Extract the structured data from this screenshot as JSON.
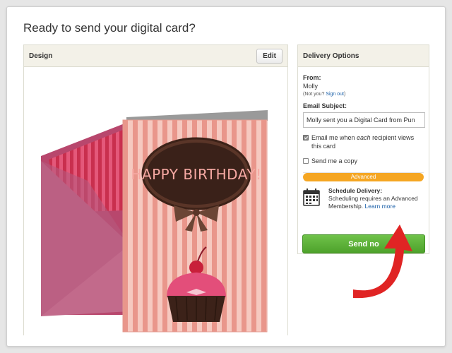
{
  "page": {
    "title": "Ready to send your digital card?"
  },
  "design": {
    "header": "Design",
    "edit_label": "Edit",
    "card_text": "HAPPY BIRTHDAY!"
  },
  "delivery": {
    "header": "Delivery Options",
    "from_label": "From:",
    "sender_name": "Molly",
    "not_you_prefix": "(Not you? ",
    "sign_out_label": "Sign out",
    "not_you_suffix": ")",
    "email_subject_label": "Email Subject:",
    "email_subject_value": "Molly sent you a Digital Card from Pun",
    "notify_prefix": "Email me when ",
    "notify_each": "each",
    "notify_suffix": " recipient views this card",
    "notify_checked": true,
    "copy_label": "Send me a copy",
    "copy_checked": false,
    "advanced_badge": "Advanced",
    "schedule_title": "Schedule Delivery:",
    "schedule_desc": "Scheduling requires an Advanced Membership. ",
    "learn_more_label": "Learn more",
    "send_label": "Send no"
  },
  "colors": {
    "send_green": "#5cb336",
    "advanced_orange": "#f5a623",
    "link_blue": "#1a5fa8",
    "arrow_red": "#e02424"
  }
}
